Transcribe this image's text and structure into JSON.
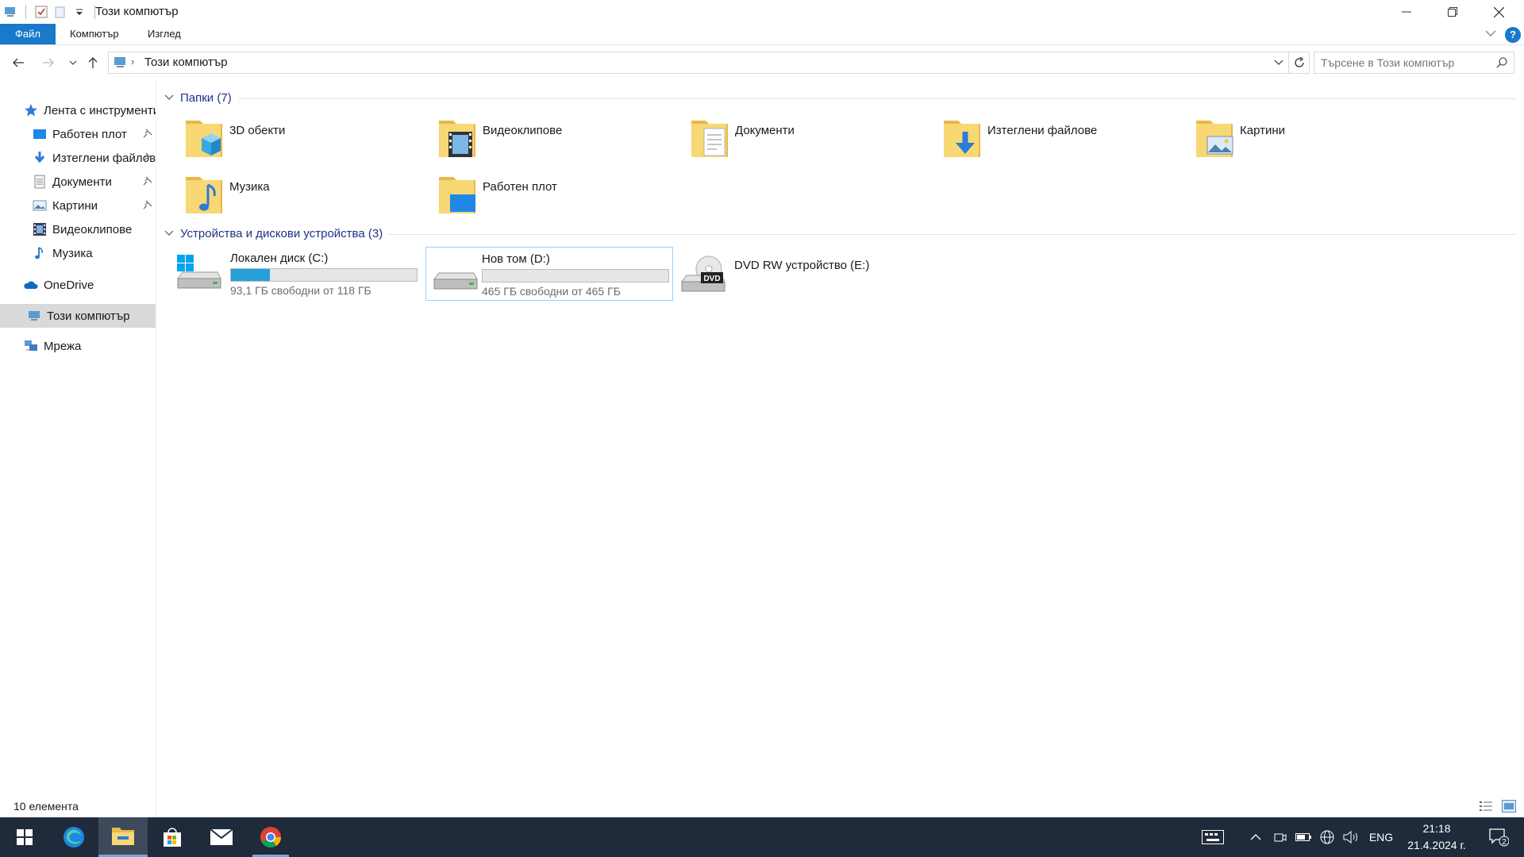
{
  "window": {
    "title": "Този компютър"
  },
  "ribbon": {
    "tabs": [
      "Файл",
      "Компютър",
      "Изглед"
    ],
    "help": "?"
  },
  "address": {
    "crumb": "Този компютър",
    "search_placeholder": "Търсене в Този компютър"
  },
  "sidebar": {
    "quick_access": "Лента с инструменти",
    "items": [
      {
        "label": "Работен плот",
        "pinned": true
      },
      {
        "label": "Изтеглени файлове",
        "pinned": true
      },
      {
        "label": "Документи",
        "pinned": true
      },
      {
        "label": "Картини",
        "pinned": true
      },
      {
        "label": "Видеоклипове",
        "pinned": false
      },
      {
        "label": "Музика",
        "pinned": false
      }
    ],
    "onedrive": "OneDrive",
    "this_pc": "Този компютър",
    "network": "Мрежа"
  },
  "folders": {
    "header": "Папки (7)",
    "items": [
      "3D обекти",
      "Видеоклипове",
      "Документи",
      "Изтеглени файлове",
      "Картини",
      "Музика",
      "Работен плот"
    ]
  },
  "devices": {
    "header": "Устройства и дискови устройства (3)",
    "items": [
      {
        "name": "Локален диск (C:)",
        "free": "93,1 ГБ свободни от 118 ГБ",
        "used_fraction": 0.21
      },
      {
        "name": "Нов том (D:)",
        "free": "465 ГБ свободни от 465 ГБ",
        "used_fraction": 0.0
      },
      {
        "name": "DVD RW устройство (E:)",
        "dvd_badge": "DVD"
      }
    ]
  },
  "status": {
    "count": "10 елемента"
  },
  "taskbar": {
    "language": "ENG",
    "time": "21:18",
    "date": "21.4.2024 г.",
    "notifications": "2"
  },
  "colors": {
    "accent": "#1979ca",
    "drive_fill": "#26a0da",
    "folder": "#f8d775",
    "taskbar": "#1f2b3a"
  }
}
